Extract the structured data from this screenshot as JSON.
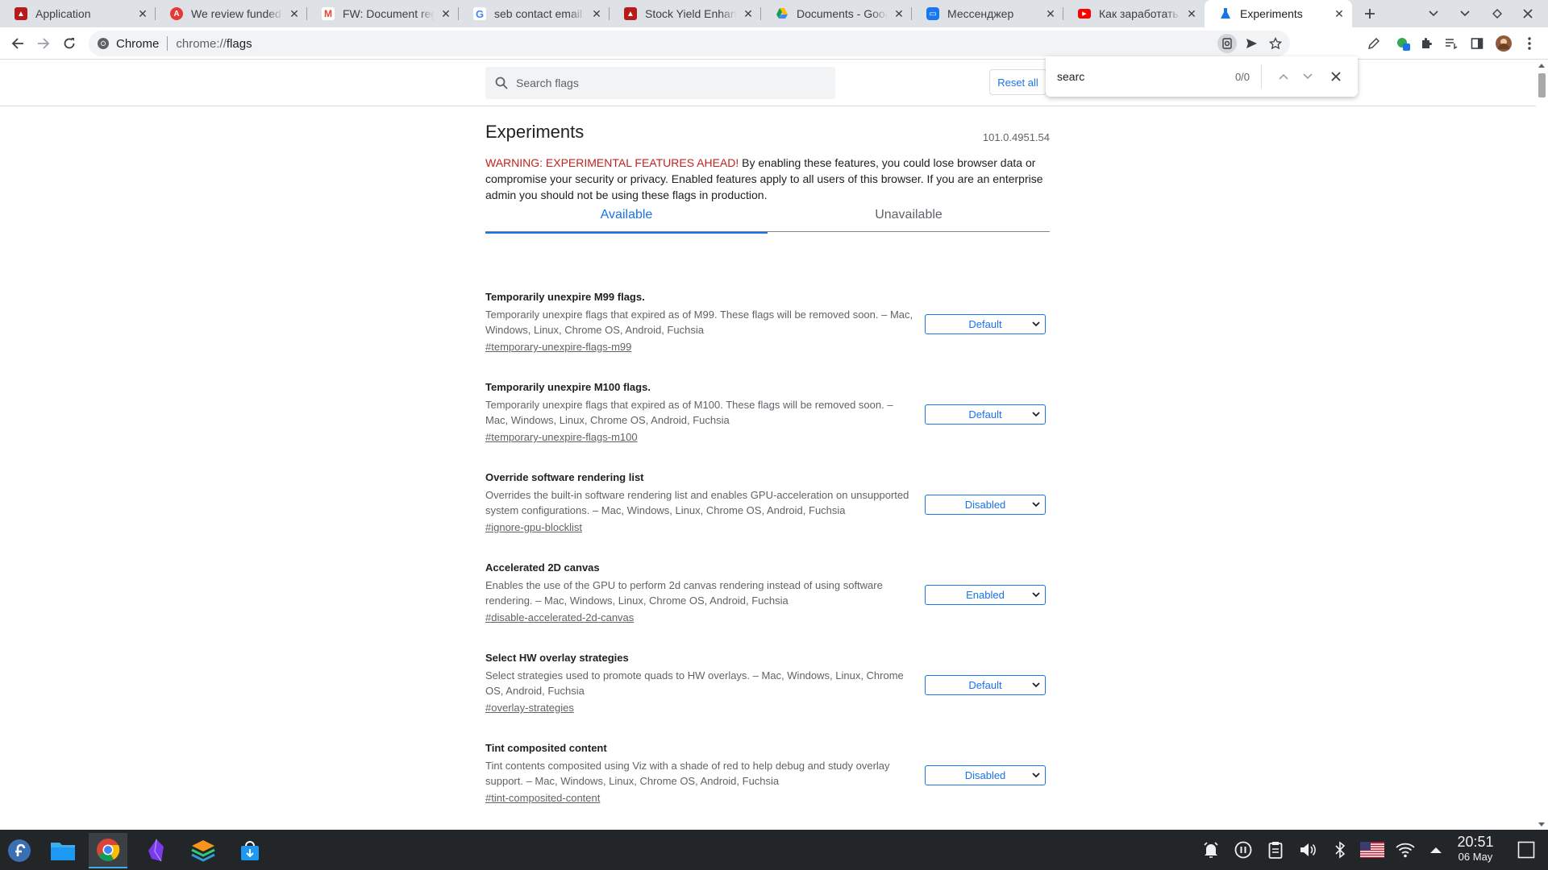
{
  "browser": {
    "tabs": [
      {
        "title": "Application",
        "favicon": "red-flame-icon",
        "color": "#b71c1c"
      },
      {
        "title": "We review funded applications",
        "favicon": "adobe-icon",
        "color": "#e53935"
      },
      {
        "title": "FW: Document regarding",
        "favicon": "gmail-icon",
        "color": "#ea4335"
      },
      {
        "title": "seb contact email - Google",
        "favicon": "google-icon",
        "color": "#4285f4"
      },
      {
        "title": "Stock Yield Enhancement",
        "favicon": "red-flame-icon",
        "color": "#b71c1c"
      },
      {
        "title": "Documents - Google Drive",
        "favicon": "google-drive-icon",
        "color": "#fbbc04"
      },
      {
        "title": "Мессенджер",
        "favicon": "messenger-icon",
        "color": "#1877f2"
      },
      {
        "title": "Как заработать на YouTube",
        "favicon": "youtube-icon",
        "color": "#ff0000"
      },
      {
        "title": "Experiments",
        "favicon": "flask-icon",
        "color": "#1a73e8",
        "active": true
      }
    ],
    "omnibox": {
      "site_label": "Chrome",
      "scheme": "chrome://",
      "path": "flags"
    }
  },
  "find_bar": {
    "query": "searc",
    "count": "0/0"
  },
  "flags_page": {
    "search_placeholder": "Search flags",
    "reset_label": "Reset all",
    "title": "Experiments",
    "version": "101.0.4951.54",
    "warning_red": "WARNING: EXPERIMENTAL FEATURES AHEAD!",
    "warning_text": " By enabling these features, you could lose browser data or compromise your security or privacy. Enabled features apply to all users of this browser. If you are an enterprise admin you should not be using these flags in production.",
    "tabs": {
      "available": "Available",
      "unavailable": "Unavailable"
    },
    "flags": [
      {
        "name": "Temporarily unexpire M99 flags.",
        "description": "Temporarily unexpire flags that expired as of M99. These flags will be removed soon. – Mac, Windows, Linux, Chrome OS, Android, Fuchsia",
        "link": "#temporary-unexpire-flags-m99",
        "value": "Default"
      },
      {
        "name": "Temporarily unexpire M100 flags.",
        "description": "Temporarily unexpire flags that expired as of M100. These flags will be removed soon. – Mac, Windows, Linux, Chrome OS, Android, Fuchsia",
        "link": "#temporary-unexpire-flags-m100",
        "value": "Default"
      },
      {
        "name": "Override software rendering list",
        "description": "Overrides the built-in software rendering list and enables GPU-acceleration on unsupported system configurations. – Mac, Windows, Linux, Chrome OS, Android, Fuchsia",
        "link": "#ignore-gpu-blocklist",
        "value": "Disabled"
      },
      {
        "name": "Accelerated 2D canvas",
        "description": "Enables the use of the GPU to perform 2d canvas rendering instead of using software rendering. – Mac, Windows, Linux, Chrome OS, Android, Fuchsia",
        "link": "#disable-accelerated-2d-canvas",
        "value": "Enabled"
      },
      {
        "name": "Select HW overlay strategies",
        "description": "Select strategies used to promote quads to HW overlays. – Mac, Windows, Linux, Chrome OS, Android, Fuchsia",
        "link": "#overlay-strategies",
        "value": "Default"
      },
      {
        "name": "Tint composited content",
        "description": "Tint contents composited using Viz with a shade of red to help debug and study overlay support. – Mac, Windows, Linux, Chrome OS, Android, Fuchsia",
        "link": "#tint-composited-content",
        "value": "Disabled"
      }
    ]
  },
  "taskbar": {
    "apps": [
      "fedora-launcher-icon",
      "file-manager-icon",
      "chrome-icon",
      "obsidian-icon",
      "layers-app-icon",
      "software-store-icon"
    ],
    "tray": [
      "alarm-icon",
      "media-pause-icon",
      "clipboard-icon",
      "volume-icon",
      "bluetooth-icon",
      "us-flag-icon",
      "wifi-icon",
      "tray-expand-icon",
      "show-desktop-icon"
    ],
    "time": "20:51",
    "date": "06 May"
  },
  "colors": {
    "accent": "#1a73e8",
    "warning": "#c5221f",
    "taskbar": "#232629"
  }
}
